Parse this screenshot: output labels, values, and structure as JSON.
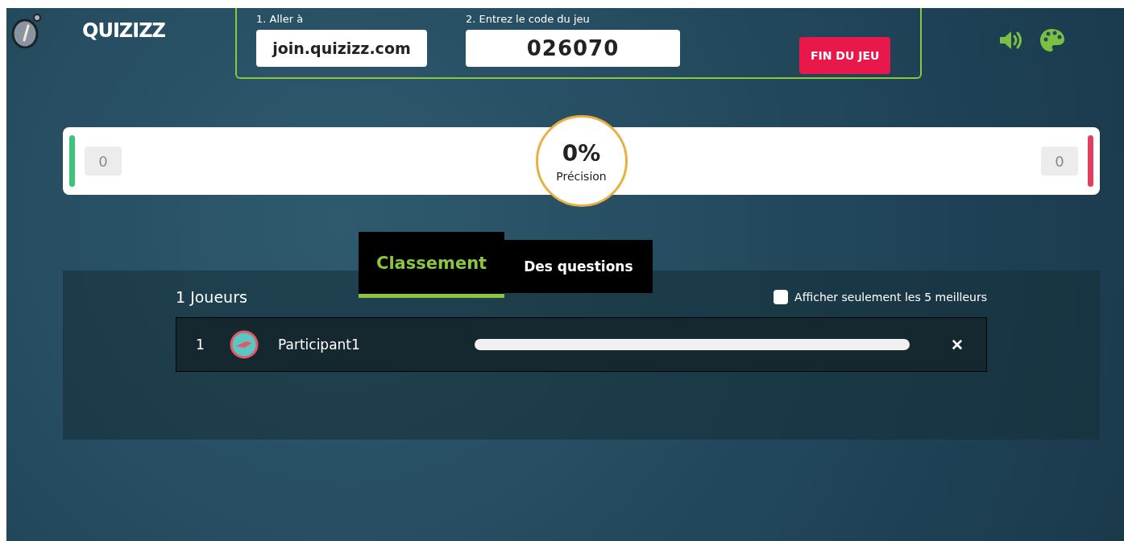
{
  "header": {
    "logo": "QUIZIZZ",
    "step1_label": "1. Aller à",
    "join_url": "join.quizizz.com",
    "step2_label": "2. Entrez le code du jeu",
    "game_code": "026070",
    "end_button": "FIN DU JEU"
  },
  "score_bar": {
    "correct": "0",
    "incorrect": "0",
    "accuracy": "0%",
    "accuracy_label": "Précision"
  },
  "tabs": [
    {
      "label": "Classement",
      "selected": true
    },
    {
      "label": "Des questions",
      "selected": false
    }
  ],
  "leaderboard": {
    "player_count": "1 Joueurs",
    "top5_label": "Afficher seulement les 5 meilleurs",
    "top5_checked": false,
    "players": [
      {
        "rank": "1",
        "name": "Participant1",
        "remove": "✕"
      }
    ]
  }
}
